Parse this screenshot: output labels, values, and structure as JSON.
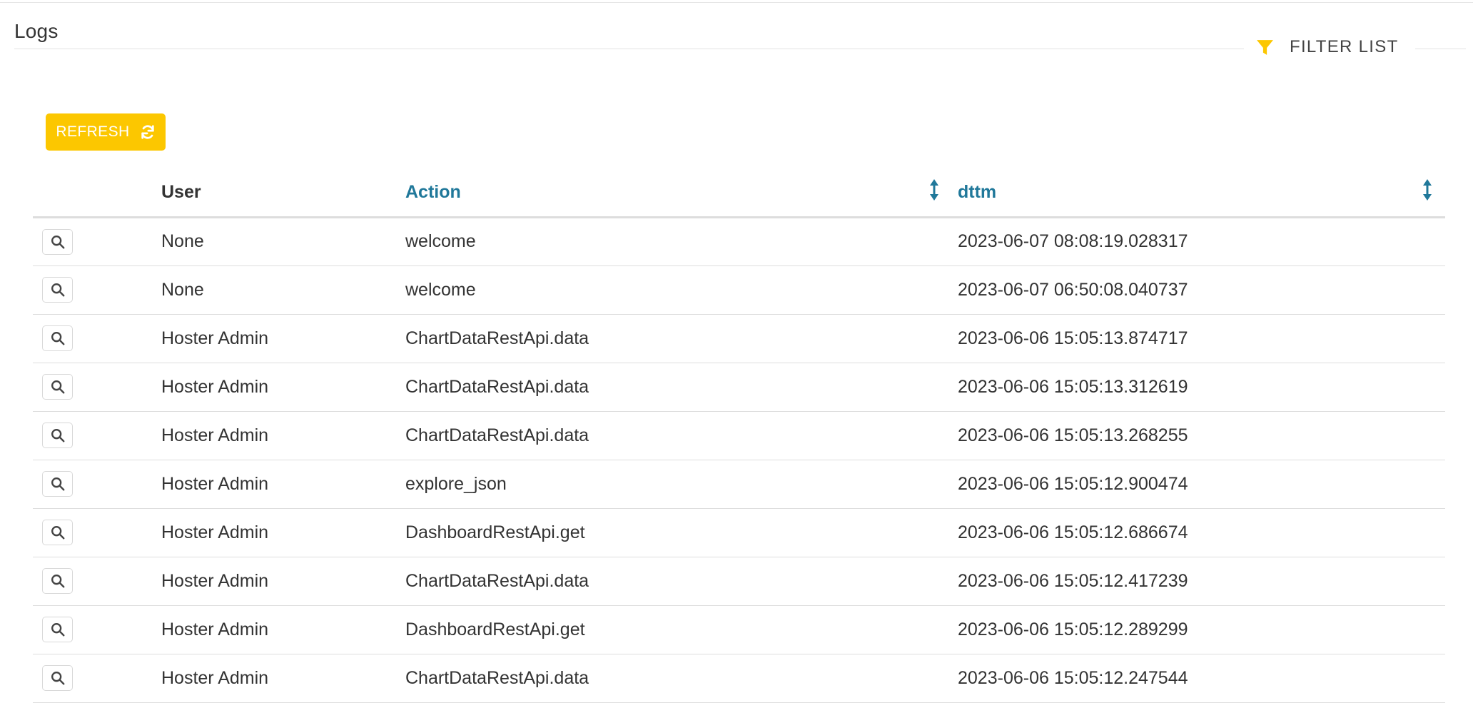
{
  "page": {
    "title": "Logs"
  },
  "toolbar": {
    "filter_label": "FILTER LIST",
    "refresh_label": "REFRESH"
  },
  "table": {
    "columns": {
      "user": "User",
      "action": "Action",
      "dttm": "dttm"
    },
    "rows": [
      {
        "user": "None",
        "action": "welcome",
        "dttm": "2023-06-07 08:08:19.028317"
      },
      {
        "user": "None",
        "action": "welcome",
        "dttm": "2023-06-07 06:50:08.040737"
      },
      {
        "user": "Hoster Admin",
        "action": "ChartDataRestApi.data",
        "dttm": "2023-06-06 15:05:13.874717"
      },
      {
        "user": "Hoster Admin",
        "action": "ChartDataRestApi.data",
        "dttm": "2023-06-06 15:05:13.312619"
      },
      {
        "user": "Hoster Admin",
        "action": "ChartDataRestApi.data",
        "dttm": "2023-06-06 15:05:13.268255"
      },
      {
        "user": "Hoster Admin",
        "action": "explore_json",
        "dttm": "2023-06-06 15:05:12.900474"
      },
      {
        "user": "Hoster Admin",
        "action": "DashboardRestApi.get",
        "dttm": "2023-06-06 15:05:12.686674"
      },
      {
        "user": "Hoster Admin",
        "action": "ChartDataRestApi.data",
        "dttm": "2023-06-06 15:05:12.417239"
      },
      {
        "user": "Hoster Admin",
        "action": "DashboardRestApi.get",
        "dttm": "2023-06-06 15:05:12.289299"
      },
      {
        "user": "Hoster Admin",
        "action": "ChartDataRestApi.data",
        "dttm": "2023-06-06 15:05:12.247544"
      }
    ]
  },
  "icons": {
    "filter": "filter-icon",
    "refresh": "refresh-icon",
    "sort": "sort-icon",
    "view": "search-icon"
  },
  "colors": {
    "accent": "#fcc700",
    "link": "#20789a",
    "text": "#333333",
    "border": "#dddddd"
  }
}
